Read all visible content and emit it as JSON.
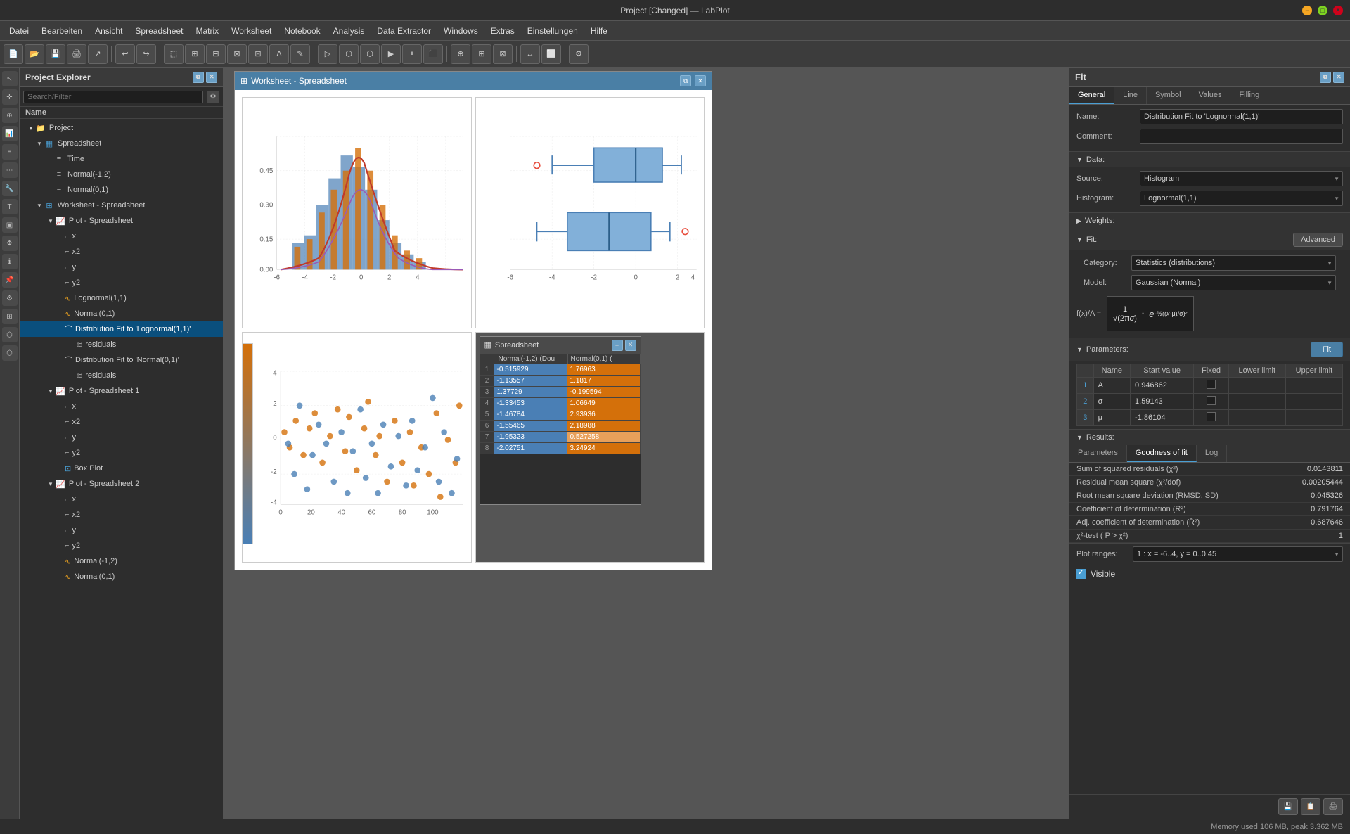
{
  "titlebar": {
    "title": "Project [Changed] — LabPlot",
    "minimize": "−",
    "maximize": "□",
    "close": "✕"
  },
  "menubar": {
    "items": [
      "Datei",
      "Bearbeiten",
      "Ansicht",
      "Spreadsheet",
      "Matrix",
      "Worksheet",
      "Notebook",
      "Analysis",
      "Data Extractor",
      "Windows",
      "Extras",
      "Einstellungen",
      "Hilfe"
    ]
  },
  "project_explorer": {
    "title": "Project Explorer",
    "search_placeholder": "Search/Filter",
    "col_name": "Name",
    "tree": [
      {
        "label": "Project",
        "level": 0,
        "type": "folder",
        "expanded": true
      },
      {
        "label": "Spreadsheet",
        "level": 1,
        "type": "spreadsheet",
        "expanded": true
      },
      {
        "label": "Time",
        "level": 2,
        "type": "column"
      },
      {
        "label": "Normal(-1,2)",
        "level": 2,
        "type": "column"
      },
      {
        "label": "Normal(0,1)",
        "level": 2,
        "type": "column"
      },
      {
        "label": "Worksheet - Spreadsheet",
        "level": 1,
        "type": "worksheet",
        "expanded": true
      },
      {
        "label": "Plot - Spreadsheet",
        "level": 2,
        "type": "plot",
        "expanded": true
      },
      {
        "label": "x",
        "level": 3,
        "type": "axis"
      },
      {
        "label": "x2",
        "level": 3,
        "type": "axis"
      },
      {
        "label": "y",
        "level": 3,
        "type": "axis"
      },
      {
        "label": "y2",
        "level": 3,
        "type": "axis"
      },
      {
        "label": "Lognormal(1,1)",
        "level": 3,
        "type": "dist"
      },
      {
        "label": "Normal(0,1)",
        "level": 3,
        "type": "dist"
      },
      {
        "label": "Distribution Fit to 'Lognormal(1,1)'",
        "level": 3,
        "type": "fit",
        "selected": true
      },
      {
        "label": "residuals",
        "level": 4,
        "type": "residuals"
      },
      {
        "label": "Distribution Fit to 'Normal(0,1)'",
        "level": 3,
        "type": "fit"
      },
      {
        "label": "residuals",
        "level": 4,
        "type": "residuals"
      },
      {
        "label": "Plot - Spreadsheet 1",
        "level": 2,
        "type": "plot",
        "expanded": true
      },
      {
        "label": "x",
        "level": 3,
        "type": "axis"
      },
      {
        "label": "x2",
        "level": 3,
        "type": "axis"
      },
      {
        "label": "y",
        "level": 3,
        "type": "axis"
      },
      {
        "label": "y2",
        "level": 3,
        "type": "axis"
      },
      {
        "label": "Box Plot",
        "level": 3,
        "type": "boxplot"
      },
      {
        "label": "Plot - Spreadsheet 2",
        "level": 2,
        "type": "plot",
        "expanded": true
      },
      {
        "label": "x",
        "level": 3,
        "type": "axis"
      },
      {
        "label": "x2",
        "level": 3,
        "type": "axis"
      },
      {
        "label": "y",
        "level": 3,
        "type": "axis"
      },
      {
        "label": "y2",
        "level": 3,
        "type": "axis"
      },
      {
        "label": "Normal(-1,2)",
        "level": 3,
        "type": "dist"
      },
      {
        "label": "Normal(0,1)",
        "level": 3,
        "type": "dist"
      }
    ]
  },
  "worksheet": {
    "title": "Worksheet - Spreadsheet"
  },
  "spreadsheet_popup": {
    "title": "Spreadsheet",
    "cols": [
      "Normal(-1,2) (Dou",
      "Normal(0,1) ("
    ],
    "rows": [
      {
        "num": 1,
        "col1": "-0.515929",
        "col2": "1.76963",
        "col1_type": "blue",
        "col2_type": "orange"
      },
      {
        "num": 2,
        "col1": "-1.13557",
        "col2": "1.1817",
        "col1_type": "blue",
        "col2_type": "orange"
      },
      {
        "num": 3,
        "col1": "1.37729",
        "col2": "-0.199594",
        "col1_type": "blue",
        "col2_type": "orange"
      },
      {
        "num": 4,
        "col1": "-1.33453",
        "col2": "1.06649",
        "col1_type": "blue",
        "col2_type": "orange"
      },
      {
        "num": 5,
        "col1": "-1.46784",
        "col2": "2.93936",
        "col1_type": "blue",
        "col2_type": "orange"
      },
      {
        "num": 6,
        "col1": "-1.55465",
        "col2": "2.18988",
        "col1_type": "blue",
        "col2_type": "orange"
      },
      {
        "num": 7,
        "col1": "-1.95323",
        "col2": "0.527258",
        "col1_type": "blue",
        "col2_type": "orange"
      },
      {
        "num": 8,
        "col1": "-2.02751",
        "col2": "3.24924",
        "col1_type": "blue",
        "col2_type": "orange"
      }
    ]
  },
  "fit_panel": {
    "title": "Fit",
    "tabs": {
      "main": [
        "General",
        "Line",
        "Symbol",
        "Values",
        "Filling"
      ],
      "results": [
        "Parameters",
        "Goodness of fit",
        "Log"
      ]
    },
    "general": {
      "name_label": "Name:",
      "name_value": "Distribution Fit to 'Lognormal(1,1)'",
      "comment_label": "Comment:",
      "comment_value": "",
      "data_section": "Data:",
      "source_label": "Source:",
      "source_value": "Histogram",
      "histogram_label": "Histogram:",
      "histogram_value": "Lognormal(1,1)",
      "weights_section": "Weights:",
      "fit_section": "Fit:",
      "advanced_btn": "Advanced",
      "category_label": "Category:",
      "category_value": "Statistics (distributions)",
      "model_label": "Model:",
      "model_value": "Gaussian (Normal)",
      "formula_label": "f(x)/A =",
      "formula": "1/(√(2πσ)) · e^(-½((x-μ)/σ)²)"
    },
    "parameters": {
      "columns": [
        "Name",
        "Start value",
        "Fixed",
        "Lower limit",
        "Upper limit"
      ],
      "rows": [
        {
          "num": 1,
          "name": "A",
          "start": "0.946862",
          "fixed": false,
          "lower": "",
          "upper": ""
        },
        {
          "num": 2,
          "name": "σ",
          "start": "1.59143",
          "fixed": false,
          "lower": "",
          "upper": ""
        },
        {
          "num": 3,
          "name": "μ",
          "start": "-1.86104",
          "fixed": false,
          "lower": "",
          "upper": ""
        }
      ],
      "fit_btn": "Fit"
    },
    "results": {
      "active_tab": "Goodness of fit",
      "rows": [
        {
          "label": "Sum of squared residuals (χ²)",
          "value": "0.0143811"
        },
        {
          "label": "Residual mean square (χ²/dof)",
          "value": "0.00205444"
        },
        {
          "label": "Root mean square deviation (RMSD, SD)",
          "value": "0.045326"
        },
        {
          "label": "Coefficient of determination (R²)",
          "value": "0.791764"
        },
        {
          "label": "Adj. coefficient of determination (R̄²)",
          "value": "0.687646"
        },
        {
          "label": "χ²-test ( P > χ²)",
          "value": "1"
        }
      ]
    },
    "plot_ranges_label": "Plot ranges:",
    "plot_ranges_value": "1 : x = -6..4, y = 0..0.45",
    "visible_label": "Visible"
  },
  "statusbar": {
    "memory": "Memory used 106 MB, peak 3.362 MB"
  }
}
